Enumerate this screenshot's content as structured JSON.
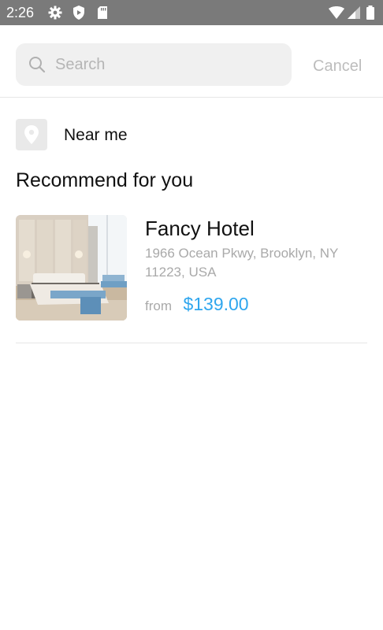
{
  "status_bar": {
    "time": "2:26",
    "icons_left": [
      "gear-icon",
      "shield-icon",
      "sd-card-icon"
    ],
    "icons_right": [
      "wifi-icon",
      "signal-icon",
      "battery-icon"
    ]
  },
  "search": {
    "placeholder": "Search",
    "value": "",
    "cancel_label": "Cancel"
  },
  "near_me": {
    "label": "Near me",
    "icon": "location-pin-icon"
  },
  "section": {
    "title": "Recommend for you"
  },
  "hotels": [
    {
      "name": "Fancy Hotel",
      "address": "1966 Ocean Pkwy, Brooklyn, NY 11223, USA",
      "from_label": "from",
      "price": "$139.00",
      "image": "hotel-room-photo"
    }
  ],
  "colors": {
    "status_bar": "#7a7a7a",
    "price": "#2fa6ee",
    "muted_text": "#a9a9a9",
    "search_bg": "#f0f0f0"
  }
}
